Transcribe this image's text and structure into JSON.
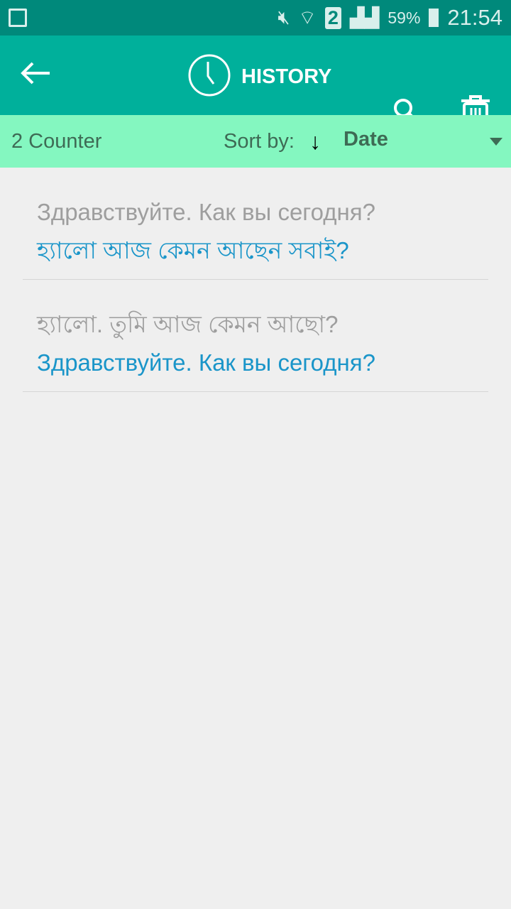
{
  "status_bar": {
    "battery": "59%",
    "time": "21:54",
    "sim": "2"
  },
  "app_bar": {
    "title": "HISTORY"
  },
  "sort_bar": {
    "counter": "2 Counter",
    "sort_label": "Sort by:",
    "sort_value": "Date"
  },
  "history": [
    {
      "source": "Здравствуйте. Как вы сегодня?",
      "translation": "হ্যালো আজ কেমন আছেন সবাই?"
    },
    {
      "source": "হ্যালো. তুমি আজ কেমন আছো?",
      "translation": "Здравствуйте. Как вы сегодня?"
    }
  ],
  "colors": {
    "status": "#00897b",
    "appbar": "#00b09b",
    "sortbar": "#84f7c0",
    "translation": "#1a95c9"
  }
}
